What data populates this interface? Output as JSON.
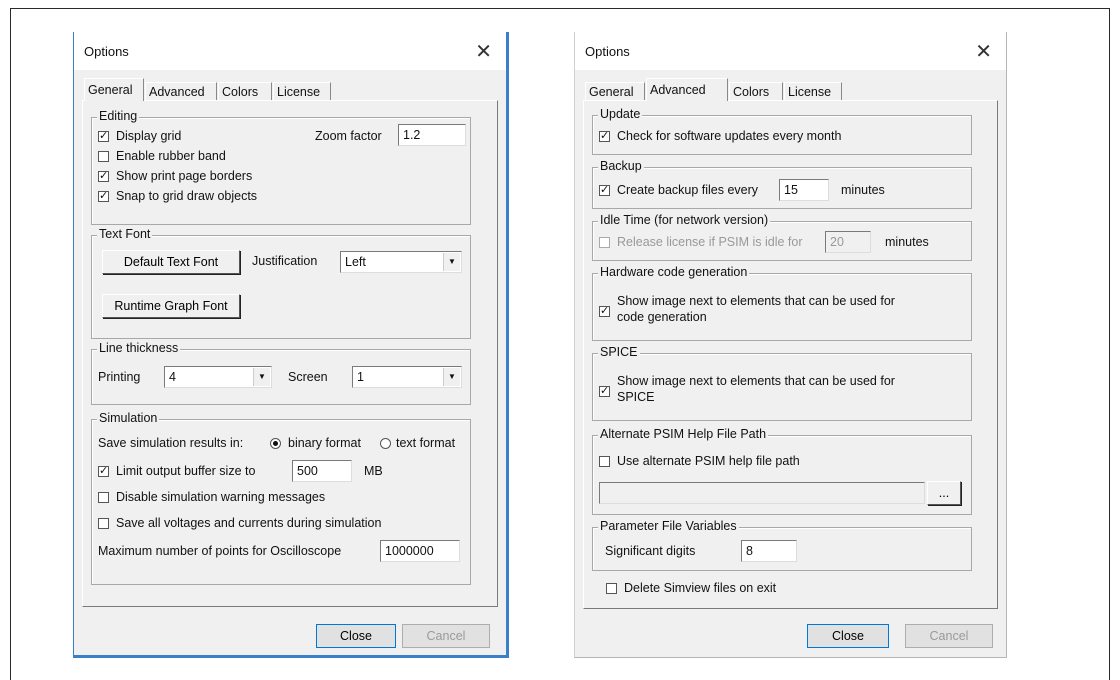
{
  "dialog_general": {
    "title": "Options",
    "tabs": [
      {
        "label": "General",
        "active": true
      },
      {
        "label": "Advanced",
        "active": false
      },
      {
        "label": "Colors",
        "active": false
      },
      {
        "label": "License",
        "active": false
      }
    ],
    "editing": {
      "legend": "Editing",
      "display_grid": {
        "label": "Display grid",
        "checked": true
      },
      "enable_rubber_band": {
        "label": "Enable rubber band",
        "checked": false
      },
      "show_print_page_borders": {
        "label": "Show print page borders",
        "checked": true
      },
      "snap_to_grid": {
        "label": "Snap to grid draw objects",
        "checked": true
      },
      "zoom_factor_label": "Zoom factor",
      "zoom_factor_value": "1.2"
    },
    "text_font": {
      "legend": "Text Font",
      "default_text_font_button": "Default Text Font",
      "justification_label": "Justification",
      "justification_value": "Left",
      "runtime_graph_font_button": "Runtime Graph Font"
    },
    "line_thickness": {
      "legend": "Line thickness",
      "printing_label": "Printing",
      "printing_value": "4",
      "screen_label": "Screen",
      "screen_value": "1"
    },
    "simulation": {
      "legend": "Simulation",
      "save_results_label": "Save simulation results in:",
      "binary_format_label": "binary format",
      "binary_format_selected": true,
      "text_format_label": "text format",
      "text_format_selected": false,
      "limit_buffer": {
        "label": "Limit output buffer size to",
        "checked": true
      },
      "buffer_value": "500",
      "buffer_unit": "MB",
      "disable_warnings": {
        "label": "Disable simulation warning messages",
        "checked": false
      },
      "save_all_voltages": {
        "label": "Save all voltages and currents during simulation",
        "checked": false
      },
      "max_points_label": "Maximum number of points for Oscilloscope",
      "max_points_value": "1000000"
    },
    "close_button": "Close",
    "cancel_button": "Cancel"
  },
  "dialog_advanced": {
    "title": "Options",
    "tabs": [
      {
        "label": "General",
        "active": false
      },
      {
        "label": "Advanced",
        "active": true
      },
      {
        "label": "Colors",
        "active": false
      },
      {
        "label": "License",
        "active": false
      }
    ],
    "update": {
      "legend": "Update",
      "check_updates": {
        "label": "Check for software updates every month",
        "checked": true
      }
    },
    "backup": {
      "legend": "Backup",
      "create_backup": {
        "label": "Create backup files every",
        "checked": true
      },
      "interval_value": "15",
      "interval_unit": "minutes"
    },
    "idle_time": {
      "legend": "Idle Time (for network version)",
      "release_license": {
        "label": "Release license if PSIM is idle for",
        "checked": false
      },
      "idle_value": "20",
      "idle_unit": "minutes"
    },
    "hardware_code": {
      "legend": "Hardware code generation",
      "show_image": {
        "label_line1": "Show image next to elements that can be used for",
        "label_line2": "code generation",
        "checked": true
      }
    },
    "spice": {
      "legend": "SPICE",
      "show_image": {
        "label_line1": "Show image next to elements that can be used for",
        "label_line2": "SPICE",
        "checked": true
      }
    },
    "help_path": {
      "legend": "Alternate PSIM Help File Path",
      "use_alternate": {
        "label": "Use alternate PSIM help file path",
        "checked": false
      },
      "path_value": "",
      "browse_button": "..."
    },
    "param_file": {
      "legend": "Parameter File Variables",
      "significant_digits_label": "Significant digits",
      "significant_digits_value": "8"
    },
    "delete_simview": {
      "label": "Delete Simview files on exit",
      "checked": false
    },
    "close_button": "Close",
    "cancel_button": "Cancel"
  }
}
